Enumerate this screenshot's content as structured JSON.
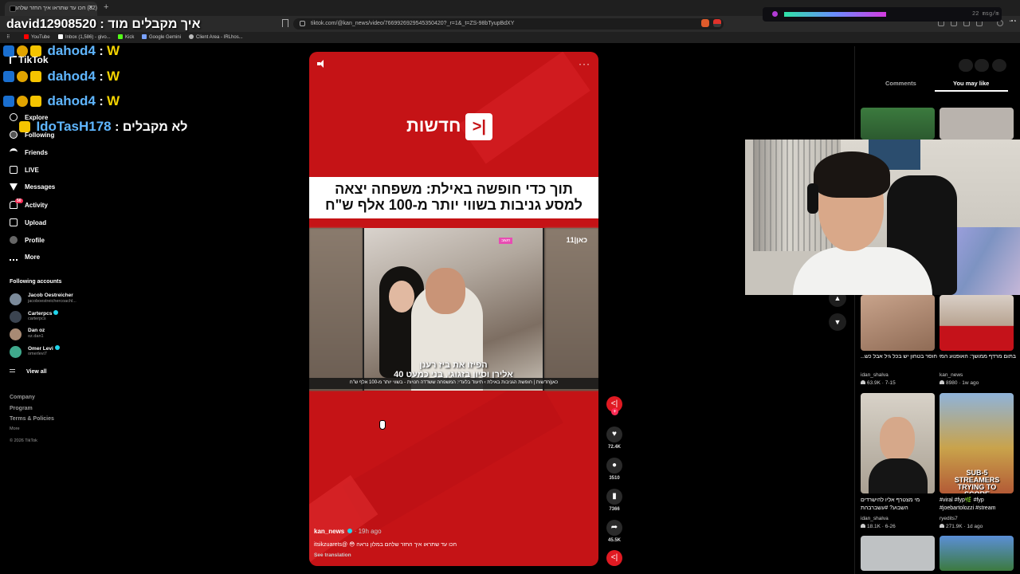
{
  "browser": {
    "tab_title": "(32) חכו עד שתראו איך החזר שלהם",
    "url": "tiktok.com/@kan_news/video/7669926929545350420?_r=1&_t=ZS-98bTyupBdXY",
    "bookmarks": [
      "YouTube",
      "Inbox (1,586) - givo...",
      "Kick",
      "Google Gemini",
      "Client Area - IRLhos..."
    ]
  },
  "stream_overlay": {
    "msg_rate": "22 msg/m"
  },
  "chat": [
    {
      "user": "david12908520",
      "sep": " : ",
      "msg": "איך מקבלים מוד"
    },
    {
      "user": "dahod4",
      "sep": " : ",
      "msg": "W"
    },
    {
      "user": "dahod4",
      "sep": " : ",
      "msg": "W"
    },
    {
      "user": "dahod4",
      "sep": " : ",
      "msg": "W"
    },
    {
      "user": "IdoTasH178",
      "sep": " : ",
      "msg": "לא מקבלים"
    }
  ],
  "sidebar": {
    "logo": "TikTok",
    "items": [
      {
        "label": "Explore",
        "icon": "compass-icon"
      },
      {
        "label": "Following",
        "icon": "following-icon"
      },
      {
        "label": "Friends",
        "icon": "friends-icon"
      },
      {
        "label": "LIVE",
        "icon": "live-icon"
      },
      {
        "label": "Messages",
        "icon": "messages-icon"
      },
      {
        "label": "Activity",
        "icon": "activity-icon",
        "badge": "50"
      },
      {
        "label": "Upload",
        "icon": "upload-icon"
      },
      {
        "label": "Profile",
        "icon": "profile-icon"
      },
      {
        "label": "More",
        "icon": "more-icon"
      }
    ],
    "following_title": "Following accounts",
    "accounts": [
      {
        "name": "Jacob Oestreicher",
        "handle": "jacoboestreichercoachl...",
        "verified": false
      },
      {
        "name": "Carterpcs",
        "handle": "carterpcs",
        "verified": true
      },
      {
        "name": "Dan oz",
        "handle": "oz.dan1",
        "verified": false
      },
      {
        "name": "Omer Levi",
        "handle": "omerlevi7",
        "verified": true
      }
    ],
    "view_all": "View all",
    "footer": [
      "Company",
      "Program",
      "Terms & Policies",
      "More",
      "© 2026 TikTok"
    ]
  },
  "video": {
    "channel_logo_text": "חדשות",
    "channel_logo_mark": "|<",
    "headline_line1": "תוך כדי חופשה באילת: משפחה יצאה",
    "headline_line2": "למסע גניבות בשווי יותר מ-100 אלף ש\"ח",
    "image_caption_line1": "הפיזו את ביז רענן",
    "image_caption_line2": "אלירן וסיון בזגוגי, בני כמעט 40",
    "kan_tag": "כאן|11",
    "pink_tag": "חשוב",
    "ticker": "כאן|חדשות | חופשת הגניבות באילת › תיעוד בלעדי: המשפחה ששדדה חנויות - בשווי יותר מ-100 אלף ש\"ח",
    "author": "kan_news",
    "time": "· 19h ago",
    "description": "חכו עד שתראו איך החזר שלהם במלון נראה 😳 @itsikzuarets",
    "see_translation": "See translation"
  },
  "actions": {
    "likes": "72.4K",
    "comments": "3510",
    "saves": "7366",
    "shares": "45.5K"
  },
  "right_panel": {
    "tab_comments": "Comments",
    "tab_you_may_like": "You may like",
    "cards": [
      {
        "caption": "חוסר בטחון יש בכל גיל אבל כש...",
        "user": "idan_shalva",
        "stats": "63.9K · 7-15"
      },
      {
        "caption": "בתום מרדף ממושך: האופנוע המשטרה נעצר את אבא...",
        "user": "kan_news",
        "stats": "8980 · 1w ago"
      },
      {
        "caption": "מי מצטרף אליו להישרדים השבוע? #עשברבהת",
        "user": "idan_shalva",
        "stats": "18.1K · 6-26"
      },
      {
        "caption": "#viral #fyp🌿 #fyp #joebartolozzi #stream",
        "user": "ryedits7",
        "stats": "271.9K · 1d ago"
      }
    ],
    "thumb_text_1": "SUB-5 STREAMERS TRYING TO SCORE"
  }
}
